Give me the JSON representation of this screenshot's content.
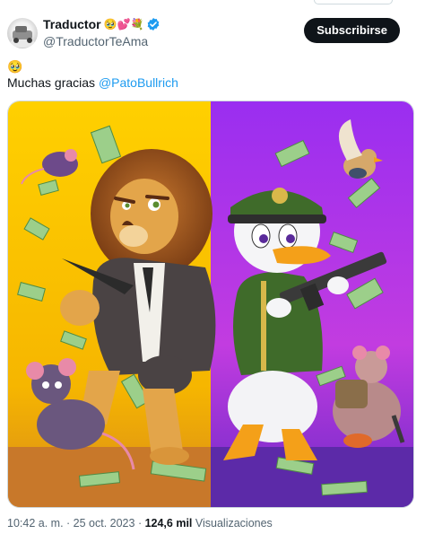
{
  "author": {
    "display_name": "Traductor",
    "name_emojis": "🥹💕💐",
    "handle": "@TraductorTeAma",
    "verified_icon": "verified-badge-icon",
    "avatar_icon": "avatar-photo"
  },
  "subscribe_label": "Subscribirse",
  "tweet": {
    "emoji_line": "🥹",
    "text_prefix": "Muchas gracias ",
    "mention": "@PatoBullrich"
  },
  "media": {
    "description_icon": "cartoon-lion-and-duck-image",
    "colors": {
      "left_bg": "#f7d215",
      "right_bg": "#b52ee8"
    }
  },
  "meta": {
    "time": "10:42 a. m.",
    "sep1": " · ",
    "date": "25 oct. 2023",
    "sep2": " · ",
    "views_count": "124,6 mil",
    "views_label": " Visualizaciones"
  },
  "colors": {
    "link": "#1d9bf0",
    "secondary_text": "#536471",
    "button_bg": "#0f1419"
  }
}
